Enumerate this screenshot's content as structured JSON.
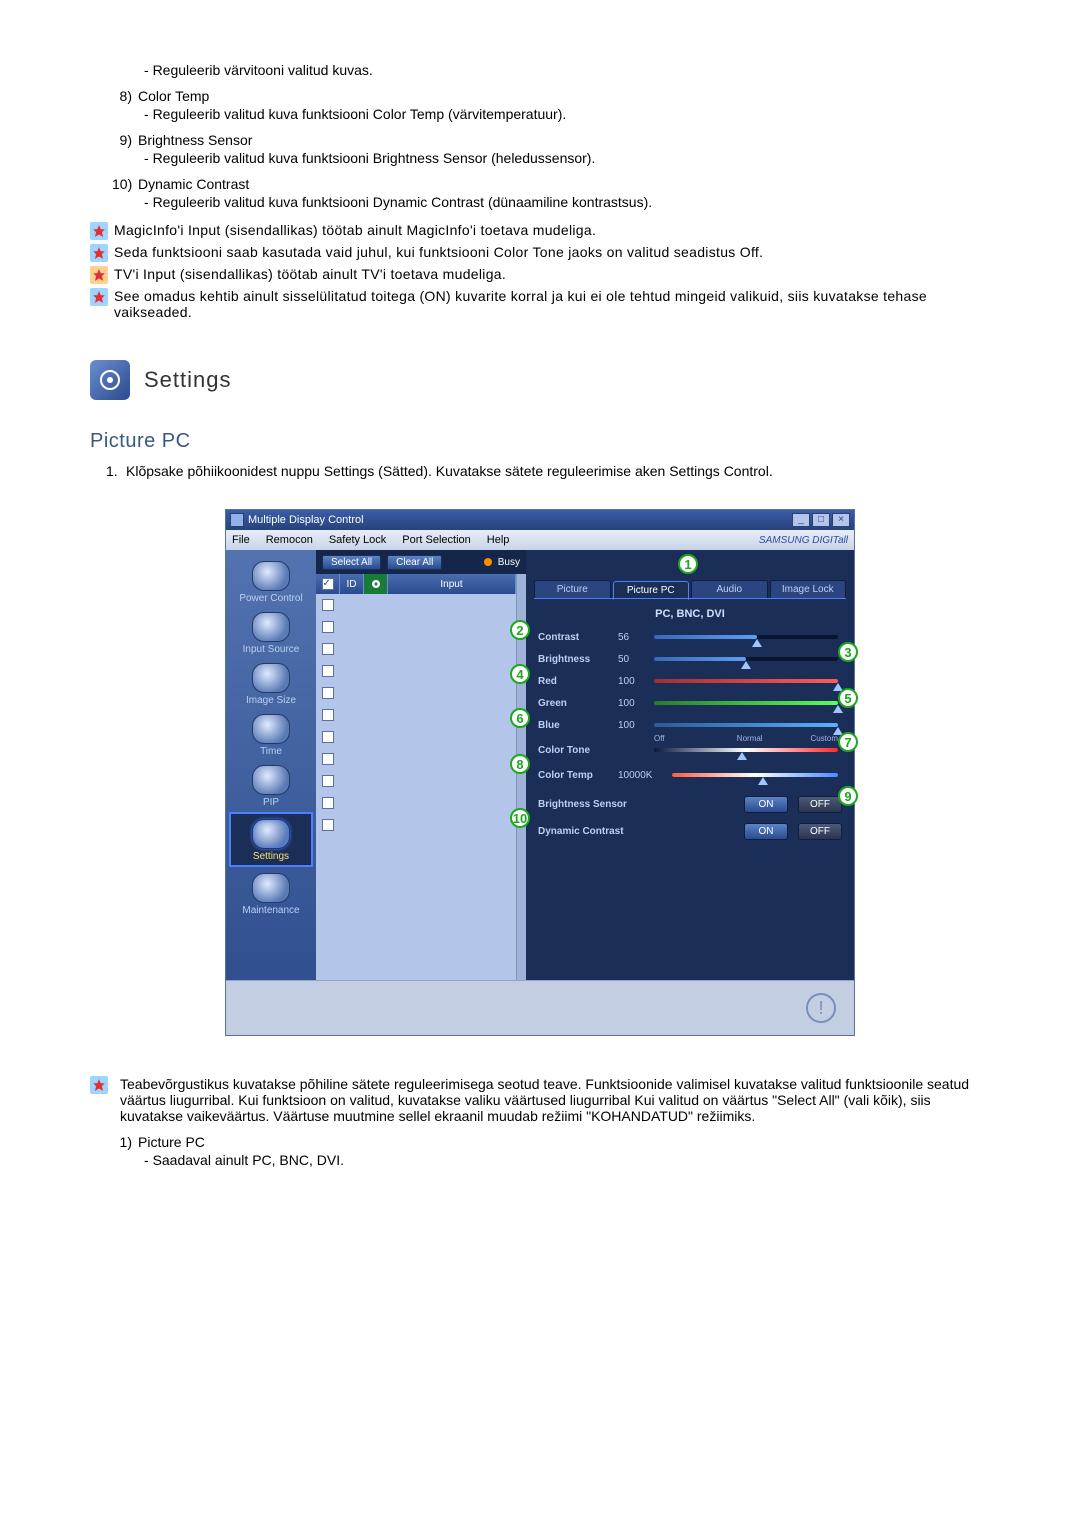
{
  "top_items": [
    {
      "n": "",
      "title": "",
      "desc": "Reguleerib värvitooni valitud kuvas."
    },
    {
      "n": "8)",
      "title": "Color Temp",
      "desc": "Reguleerib valitud kuva funktsiooni Color Temp (värvitemperatuur)."
    },
    {
      "n": "9)",
      "title": "Brightness Sensor",
      "desc": "Reguleerib valitud kuva funktsiooni Brightness Sensor (heledussensor)."
    },
    {
      "n": "10)",
      "title": "Dynamic Contrast",
      "desc": "Reguleerib valitud kuva funktsiooni Dynamic Contrast (dünaamiline kontrastsus)."
    }
  ],
  "star_notes": [
    {
      "style": "blue",
      "text": "MagicInfo'i Input (sisendallikas) töötab ainult MagicInfo'i toetava mudeliga."
    },
    {
      "style": "blue",
      "text": "Seda funktsiooni saab kasutada vaid juhul, kui funktsiooni Color Tone jaoks on valitud seadistus Off."
    },
    {
      "style": "orange",
      "text": "TV'i Input (sisendallikas) töötab ainult TV'i toetava mudeliga."
    },
    {
      "style": "blue",
      "text": "See omadus kehtib ainult sisselülitatud toitega (ON) kuvarite korral ja kui ei ole tehtud mingeid valikuid, siis kuvatakse tehase vaikseaded."
    }
  ],
  "settings_heading": "Settings",
  "subtitle": "Picture PC",
  "intro_step": {
    "n": "1.",
    "text": "Klõpsake põhiikoonidest nuppu Settings (Sätted). Kuvatakse sätete reguleerimise aken Settings Control."
  },
  "app": {
    "title": "Multiple Display Control",
    "menu": [
      "File",
      "Remocon",
      "Safety Lock",
      "Port Selection",
      "Help"
    ],
    "brand": "SAMSUNG DIGITall",
    "sidebar": [
      {
        "label": "Power Control"
      },
      {
        "label": "Input Source"
      },
      {
        "label": "Image Size"
      },
      {
        "label": "Time"
      },
      {
        "label": "PIP"
      },
      {
        "label": "Settings",
        "active": true
      },
      {
        "label": "Maintenance"
      }
    ],
    "list_toolbar": {
      "select_all": "Select All",
      "clear_all": "Clear All",
      "busy": "Busy"
    },
    "list_header": {
      "chk": "✓",
      "id": "ID",
      "stat": "",
      "input": "Input"
    },
    "list_rows_count": 11,
    "tabs": [
      "Picture",
      "Picture PC",
      "Audio",
      "Image Lock"
    ],
    "active_tab": 1,
    "sub_head": "PC, BNC, DVI",
    "sliders": [
      {
        "label": "Contrast",
        "val": "56",
        "fill": "blue",
        "pct": 56
      },
      {
        "label": "Brightness",
        "val": "50",
        "fill": "blue",
        "pct": 50
      },
      {
        "label": "Red",
        "val": "100",
        "fill": "red",
        "pct": 100
      },
      {
        "label": "Green",
        "val": "100",
        "fill": "green",
        "pct": 100
      },
      {
        "label": "Blue",
        "val": "100",
        "fill": "bluec",
        "pct": 100
      }
    ],
    "color_tone": {
      "label": "Color Tone",
      "off": "Off",
      "normal": "Normal",
      "custom": "Custom",
      "pos": 48
    },
    "color_temp": {
      "label": "Color Temp",
      "val": "10000K",
      "pct": 55
    },
    "toggles": [
      {
        "label": "Brightness Sensor",
        "on": "ON",
        "off": "OFF"
      },
      {
        "label": "Dynamic Contrast",
        "on": "ON",
        "off": "OFF"
      }
    ],
    "callouts": {
      "c1": "1",
      "c2": "2",
      "c3": "3",
      "c4": "4",
      "c5": "5",
      "c6": "6",
      "c7": "7",
      "c8": "8",
      "c9": "9",
      "c10": "10"
    }
  },
  "bottom_note": "Teabevõrgustikus kuvatakse põhiline sätete reguleerimisega seotud teave. Funktsioonide valimisel kuvatakse valitud funktsioonile seatud väärtus liugurribal. Kui funktsioon on valitud, kuvatakse valiku väärtused liugurribal Kui valitud on väärtus \"Select All\" (vali kõik), siis kuvatakse vaikeväärtus. Väärtuse muutmine sellel ekraanil muudab režiimi \"KOHANDATUD\" režiimiks.",
  "bottom_items": [
    {
      "n": "1)",
      "title": "Picture PC",
      "desc": "Saadaval ainult PC, BNC, DVI."
    }
  ]
}
